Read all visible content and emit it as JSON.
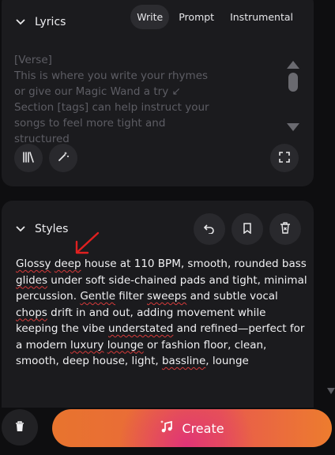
{
  "lyrics": {
    "title": "Lyrics",
    "tabs": [
      "Write",
      "Prompt",
      "Instrumental"
    ],
    "active_tab": "Write",
    "placeholder": "[Verse]\nThis is where you write your rhymes\nor give our Magic Wand a try ↙\nSection [tags] can help instruct your\nsongs to feel more tight and structured",
    "icons": [
      "library-icon",
      "magic-wand-icon",
      "expand-icon"
    ]
  },
  "styles": {
    "title": "Styles",
    "text_segments": [
      {
        "t": "Glossy",
        "err": true
      },
      {
        "t": " ",
        "err": false
      },
      {
        "t": "deep",
        "err": true
      },
      {
        "t": " house at 110 BPM, smooth, rounded bass ",
        "err": false
      },
      {
        "t": "glides",
        "err": true
      },
      {
        "t": " under soft side-chained pads and tight, minimal percussion. ",
        "err": false
      },
      {
        "t": "Gentle",
        "err": true
      },
      {
        "t": " filter ",
        "err": false
      },
      {
        "t": "sweeps",
        "err": true
      },
      {
        "t": " and subtle vocal ",
        "err": false
      },
      {
        "t": "chops",
        "err": true
      },
      {
        "t": " drift in and out, adding movement while keeping the vibe ",
        "err": false
      },
      {
        "t": "understated",
        "err": true
      },
      {
        "t": " and refined—perfect for a modern ",
        "err": false
      },
      {
        "t": "luxury",
        "err": true
      },
      {
        "t": " ",
        "err": false
      },
      {
        "t": "lounge",
        "err": true
      },
      {
        "t": " or fashion floor, clean, smooth, deep house, light, ",
        "err": false
      },
      {
        "t": "bassline",
        "err": true
      },
      {
        "t": ", lounge",
        "err": false
      }
    ],
    "icons": [
      "undo-icon",
      "bookmark-icon",
      "clear-icon"
    ]
  },
  "create_button": {
    "label": "Create"
  },
  "colors": {
    "accent_start": "#e8742e",
    "accent_mid": "#e03477",
    "panel": "#1b1b1e",
    "annotation": "#e02020"
  }
}
